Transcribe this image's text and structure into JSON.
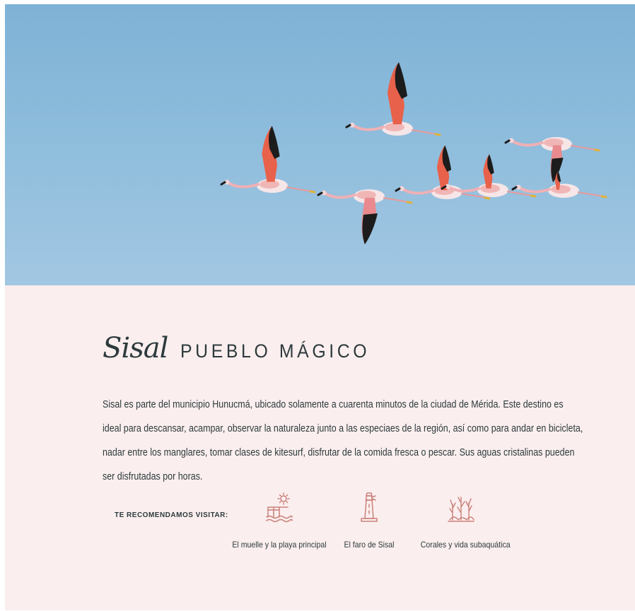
{
  "hero": {
    "image": "flamingos-flying-blue-sky",
    "colors": {
      "sky_top": "#7fb2d6",
      "sky_bottom": "#a2c7e2",
      "flamingo_body": "#f6e6e8",
      "flamingo_pink": "#e88a8e",
      "flamingo_wing": "#e8614a",
      "wing_tip": "#1c1c1c"
    }
  },
  "section": {
    "title_script": "Sisal",
    "title_main": "PUEBLO MÁGICO",
    "description": "Sisal es parte del municipio Hunucmá, ubicado solamente a cuarenta minutos de la ciudad de Mérida. Este destino es ideal para descansar, acampar, observar la naturaleza junto a las especiaes de la región, así como para andar en bicicleta, nadar entre los manglares, tomar clases de kitesurf, disfrutar de la comida fresca o pescar. Sus aguas cristalinas pueden ser disfrutadas por horas.",
    "recommend_label": "TE RECOMENDAMOS VISITAR:",
    "background": "#fbeeee",
    "icon_color": "#c9807a"
  },
  "places": [
    {
      "label": "El muelle y la playa principal",
      "icon": "pier-sun-waves-icon"
    },
    {
      "label": "El faro de Sisal",
      "icon": "lighthouse-icon"
    },
    {
      "label": "Corales y vida subaquática",
      "icon": "coral-icon"
    }
  ]
}
